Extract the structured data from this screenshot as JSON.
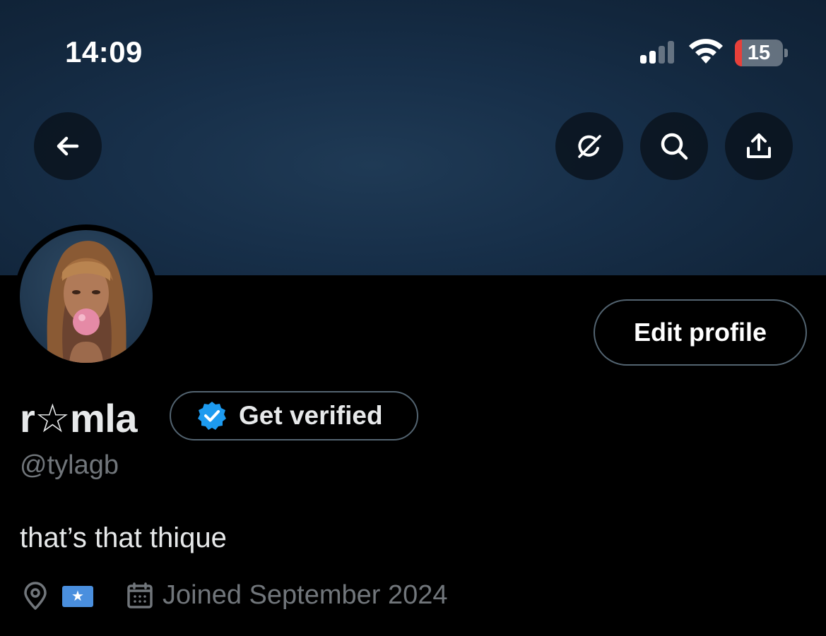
{
  "status_bar": {
    "time": "14:09",
    "battery_percent": "15",
    "battery_level": 0.15,
    "signal_bars_active": 2,
    "signal_bars_total": 4
  },
  "header": {
    "back_icon": "arrow-left-icon",
    "grok_icon": "grok-icon",
    "search_icon": "search-icon",
    "share_icon": "share-icon"
  },
  "profile": {
    "display_name": "r☆mla",
    "verify_label": "Get verified",
    "handle": "@tylagb",
    "bio": "that’s that thique",
    "location_flag": "★",
    "joined": "Joined September 2024",
    "edit_label": "Edit profile"
  },
  "colors": {
    "accent": "#1d9bf0",
    "secondary_text": "#71767b",
    "border": "#536471",
    "battery_low": "#e8403a"
  }
}
